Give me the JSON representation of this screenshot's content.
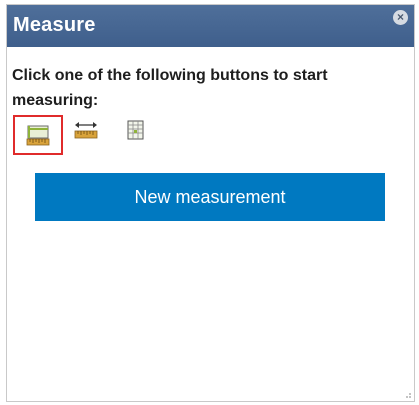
{
  "panel": {
    "title": "Measure",
    "close_symbol": "×"
  },
  "instructions": "Click one of the following buttons to start measuring:",
  "tools": [
    {
      "name": "area-tool",
      "icon": "area-ruler-icon",
      "selected": true
    },
    {
      "name": "distance-tool",
      "icon": "distance-ruler-icon",
      "selected": false
    },
    {
      "name": "location-tool",
      "icon": "location-grid-icon",
      "selected": false
    }
  ],
  "new_measurement_label": "New measurement",
  "colors": {
    "title_bar": "#44648f",
    "button": "#0079c1",
    "selection_border": "#e02b2b",
    "icon_accent": "#8fb33a"
  }
}
